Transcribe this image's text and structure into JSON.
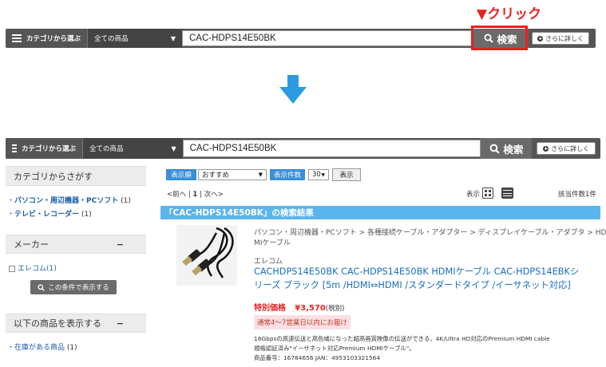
{
  "callout": "▼クリック",
  "searchbar": {
    "category_label": "カテゴリから選ぶ",
    "scope_label": "全ての商品",
    "query": "CAC-HDPS14E50BK",
    "search_label": "検索",
    "detail_label": "さらに詳しく"
  },
  "sidebar": {
    "category_heading": "カテゴリからさがす",
    "categories": [
      {
        "label": "パソコン・周辺機器・PCソフト",
        "count": "(1)"
      },
      {
        "label": "テレビ・レコーダー",
        "count": "(1)"
      }
    ],
    "maker_heading": "メーカー",
    "maker_item": "エレコム(1)",
    "condition_button": "この条件で表示する",
    "display_heading": "以下の商品を表示する",
    "stock_item": "在庫がある商品",
    "stock_count": "(1)",
    "collapse_symbol": "−"
  },
  "results": {
    "sort_label": "表示順",
    "sort_value": "おすすめ",
    "count_label": "表示件数",
    "count_value": "30",
    "show_button": "表示",
    "prev": "<前へ",
    "page_sep1": "|",
    "page": "1",
    "page_sep2": "|",
    "next": "次へ>",
    "view_label": "表示",
    "total": "該当件数1件",
    "heading": "「CAC-HDPS14E50BK」の検索結果"
  },
  "product": {
    "breadcrumb_line1": "パソコン・周辺機器・PCソフト > 各種接続ケーブル・アダプター > ディスプレイケーブル・アダプタ > HD",
    "breadcrumb_line2": "MIケーブル",
    "maker": "エレコム",
    "title_line1": "CACHDPS14E50BK CAC-HDPS14E50BK HDMIケーブル CAC-HDPS14EBKシ",
    "title_line2": "リーズ ブラック [5m /HDMI⇔HDMI /スタンダードタイプ /イーサネット対応]",
    "price_label": "特別価格",
    "price": "¥3,570",
    "tax": "(税別)",
    "delivery": "通常4～7営業日以内にお届け",
    "desc_line1": "18Gbpsの高速伝送と高色域になった超高画質映像の伝送ができる、4K/Ultra HD対応のPremium HDMI cable",
    "desc_line2": "規格認証済み\"イーサネット対応Premium HDMIケーブル\"。",
    "codes": "商品番号：16784656 JAN：4953103321564"
  },
  "colors": {
    "accent_red": "#e8221e",
    "bar_gray": "#555555",
    "blue": "#3a8fd8",
    "band_blue": "#5bb4ec",
    "price_red": "#e8221e"
  }
}
